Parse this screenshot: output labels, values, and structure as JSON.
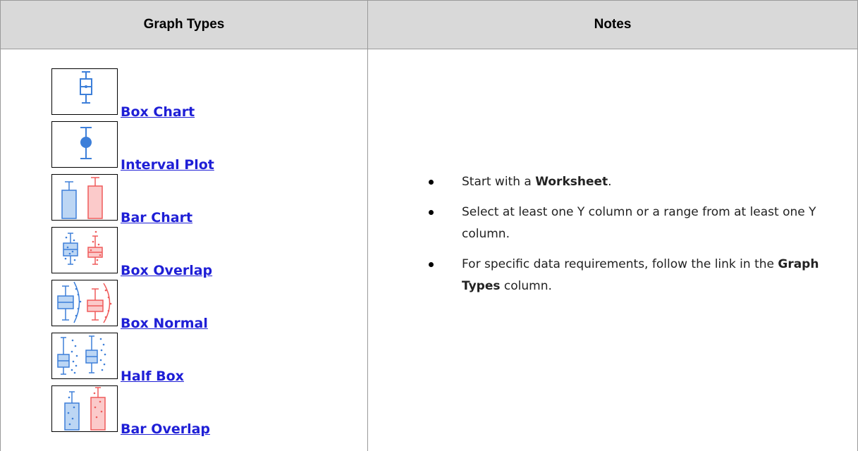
{
  "table": {
    "headers": {
      "graph_types": "Graph Types",
      "notes": "Notes"
    },
    "graph_types": [
      {
        "label": "Box Chart",
        "icon": "box-chart-icon"
      },
      {
        "label": "Interval Plot",
        "icon": "interval-plot-icon"
      },
      {
        "label": "Bar Chart",
        "icon": "bar-chart-icon"
      },
      {
        "label": "Box Overlap",
        "icon": "box-overlap-icon"
      },
      {
        "label": "Box Normal",
        "icon": "box-normal-icon"
      },
      {
        "label": "Half Box",
        "icon": "half-box-icon"
      },
      {
        "label": "Bar Overlap",
        "icon": "bar-overlap-icon"
      }
    ],
    "notes": [
      {
        "before": "Start with a ",
        "bold": "Worksheet",
        "after": "."
      },
      {
        "before": "Select at least one Y column or a range from at least one Y column.",
        "bold": "",
        "after": ""
      },
      {
        "before": "For specific data requirements, follow the link in the ",
        "bold": "Graph Types",
        "after": " column."
      }
    ]
  },
  "colors": {
    "blue": "#3d7fd9",
    "blue_fill": "#bcd6f4",
    "red": "#ef5b5b",
    "red_fill": "#fbcaca",
    "link": "#1f1fd6",
    "header_bg": "#d9d9d9"
  }
}
